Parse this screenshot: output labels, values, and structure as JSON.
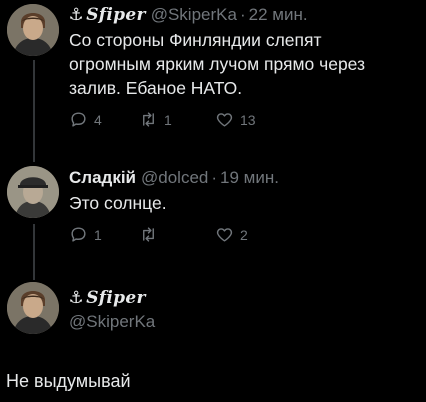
{
  "thread": [
    {
      "author": {
        "display_name": "Sfiper",
        "handle": "@SkiperKa",
        "name_prefix_glyph": "⚓"
      },
      "separator": "·",
      "time": "22 мин.",
      "text": "Со стороны Финляндии слепят огромным ярким лучом прямо через залив. Ебаное НАТО.",
      "stats": {
        "replies": "4",
        "retweets": "1",
        "likes": "13"
      }
    },
    {
      "author": {
        "display_name": "Сладкій",
        "handle": "@dolced"
      },
      "separator": "·",
      "time": "19 мин.",
      "text": "Это солнце.",
      "stats": {
        "replies": "1",
        "retweets": "",
        "likes": "2"
      }
    }
  ],
  "reply_profile": {
    "display_name": "Sfiper",
    "handle": "@SkiperKa",
    "name_prefix_glyph": "⚓"
  },
  "caption": "Не выдумывай",
  "colors": {
    "background": "#000000",
    "text_primary": "#e7e9ea",
    "text_secondary": "#71767b",
    "thread_line": "#333639"
  },
  "icons": [
    "reply-icon",
    "retweet-icon",
    "like-icon",
    "anchor-icon"
  ]
}
